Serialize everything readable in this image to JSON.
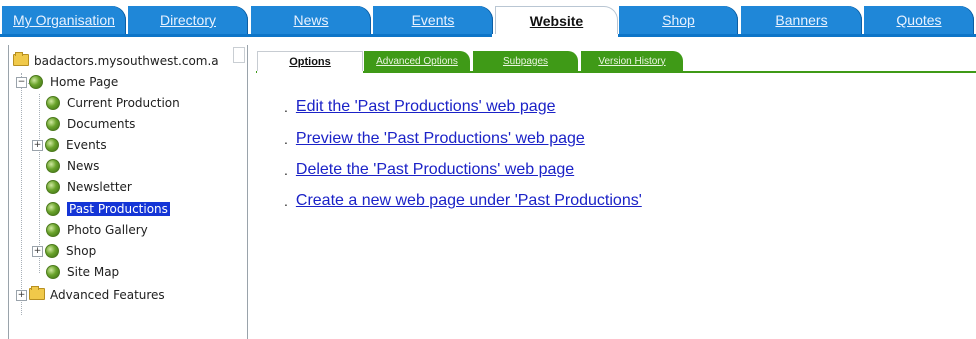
{
  "top_tabs": [
    {
      "label": "My Organisation"
    },
    {
      "label": "Directory"
    },
    {
      "label": "News"
    },
    {
      "label": "Events"
    },
    {
      "label": "Website"
    },
    {
      "label": "Shop"
    },
    {
      "label": "Banners"
    },
    {
      "label": "Quotes"
    }
  ],
  "tree": {
    "root_label": "badactors.mysouthwest.com.a",
    "items": [
      {
        "label": "Home Page"
      },
      {
        "label": "Current Production"
      },
      {
        "label": "Documents"
      },
      {
        "label": "Events"
      },
      {
        "label": "News"
      },
      {
        "label": "Newsletter"
      },
      {
        "label": "Past Productions"
      },
      {
        "label": "Photo Gallery"
      },
      {
        "label": "Shop"
      },
      {
        "label": "Site Map"
      },
      {
        "label": "Advanced Features"
      }
    ]
  },
  "sub_tabs": [
    {
      "label": "Options"
    },
    {
      "label": "Advanced Options"
    },
    {
      "label": "Subpages"
    },
    {
      "label": "Version History"
    }
  ],
  "actions": [
    {
      "label": "Edit the 'Past Productions' web page"
    },
    {
      "label": "Preview the 'Past Productions' web page"
    },
    {
      "label": "Delete the 'Past Productions' web page"
    },
    {
      "label": "Create a new web page under 'Past Productions'"
    }
  ],
  "colors": {
    "tab_blue": "#1f87d8",
    "subtab_green": "#3f9a17",
    "link_blue": "#1b22c7",
    "selection": "#1435d6"
  }
}
